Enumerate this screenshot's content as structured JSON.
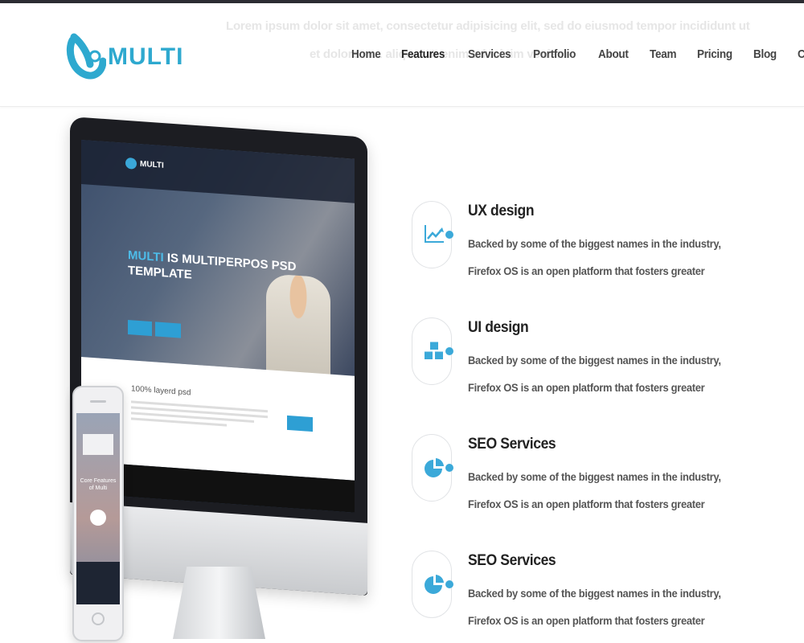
{
  "header": {
    "brand": "MULTI",
    "ghost_line_1": "Lorem ipsum dolor sit amet, consectetur adipisicing elit, sed do eiusmod tempor incididunt ut",
    "ghost_line_2": "et dolore m... aliqua. Ut enim ad minim veniam",
    "nav": [
      {
        "label": "Home"
      },
      {
        "label": "Features",
        "active": true
      },
      {
        "label": "Services"
      },
      {
        "label": "Portfolio"
      },
      {
        "label": "About"
      },
      {
        "label": "Team"
      },
      {
        "label": "Pricing"
      },
      {
        "label": "Blog"
      },
      {
        "label": "Contact"
      }
    ]
  },
  "mockup": {
    "screen_brand": "MULTI",
    "screen_title_highlight": "MULTI",
    "screen_title_rest": "IS MULTIPERPOS PSD TEMPLATE",
    "screen_section": "100% layerd psd",
    "phone_heading": "Core Features of Multi"
  },
  "features": [
    {
      "title": "UX design",
      "text": "Backed by some of the biggest names in the industry, Firefox OS is an open platform that fosters greater",
      "icon": "chart-icon"
    },
    {
      "title": "UI design",
      "text": "Backed by some of the biggest names in the industry, Firefox OS is an open platform that fosters greater",
      "icon": "cubes-icon"
    },
    {
      "title": "SEO Services",
      "text": "Backed by some of the biggest names in the industry, Firefox OS is an open platform that fosters greater",
      "icon": "pie-chart-icon"
    },
    {
      "title": "SEO Services",
      "text": "Backed by some of the biggest names in the industry, Firefox OS is an open platform that fosters greater",
      "icon": "pie-chart-icon"
    }
  ],
  "colors": {
    "accent": "#3ba9d9",
    "dark": "#2c2d33"
  }
}
